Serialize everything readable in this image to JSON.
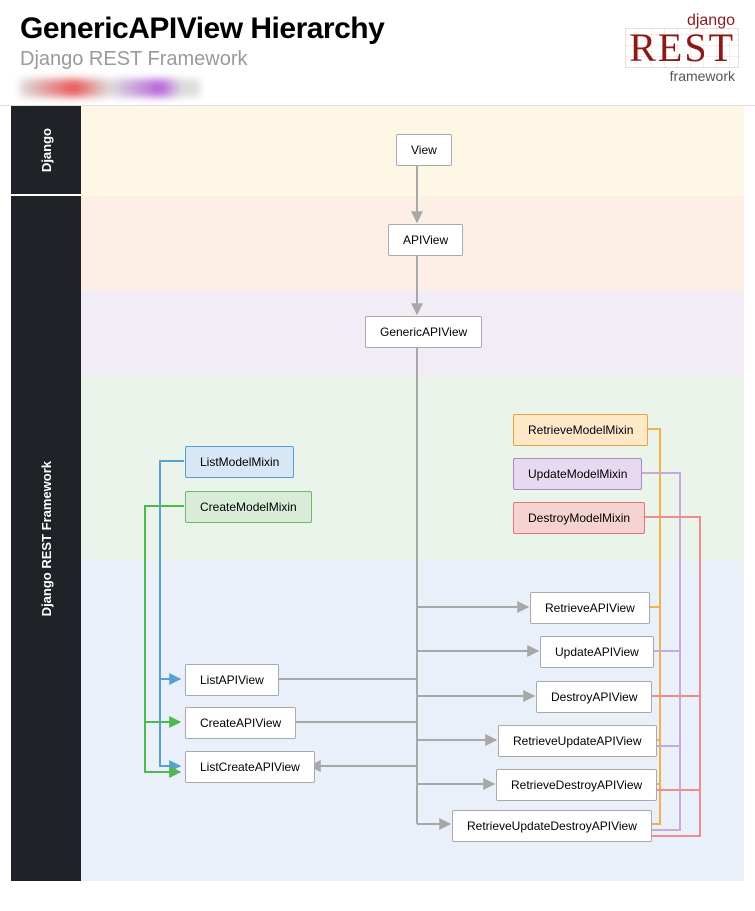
{
  "header": {
    "title": "GenericAPIView Hierarchy",
    "subtitle": "Django REST Framework"
  },
  "logo": {
    "top": "django",
    "mid": "REST",
    "bot": "framework"
  },
  "sidebar": {
    "django": "Django",
    "drf": "Django REST Framework"
  },
  "nodes": {
    "view": "View",
    "apiview": "APIView",
    "generic": "GenericAPIView",
    "list_mixin": "ListModelMixin",
    "create_mixin": "CreateModelMixin",
    "retrieve_mixin": "RetrieveModelMixin",
    "update_mixin": "UpdateModelMixin",
    "destroy_mixin": "DestroyModelMixin",
    "retrieve_view": "RetrieveAPIView",
    "update_view": "UpdateAPIView",
    "list_view": "ListAPIView",
    "destroy_view": "DestroyAPIView",
    "create_view": "CreateAPIView",
    "retrieve_update_view": "RetrieveUpdateAPIView",
    "list_create_view": "ListCreateAPIView",
    "retrieve_destroy_view": "RetrieveDestroyAPIView",
    "retrieve_update_destroy_view": "RetrieveUpdateDestroyAPIView"
  },
  "colors": {
    "edge_gray": "#a8a8a8",
    "edge_list": "#5a9fd4",
    "edge_create": "#4fb94f",
    "edge_retrieve": "#f0b24a",
    "edge_update": "#c9a9db",
    "edge_destroy": "#f08c8c"
  }
}
